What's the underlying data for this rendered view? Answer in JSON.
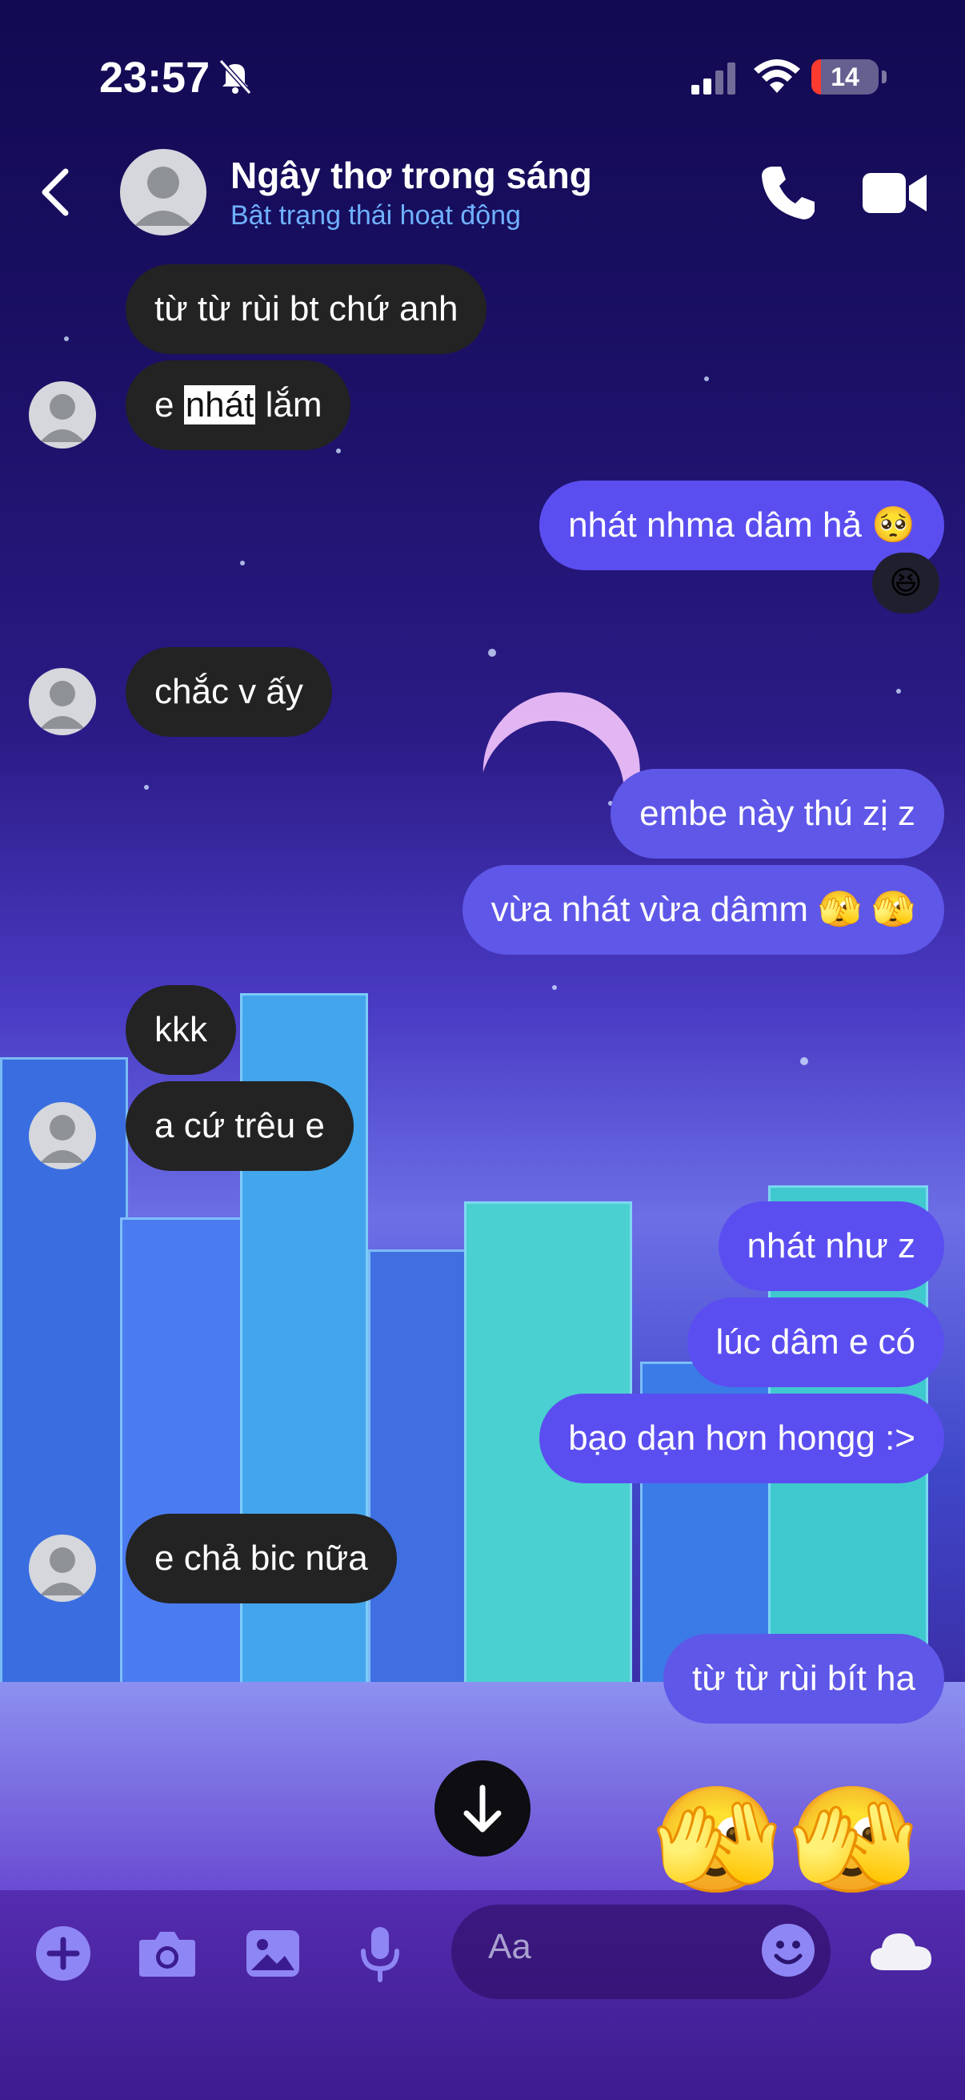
{
  "status_bar": {
    "time": "23:57",
    "battery": "14",
    "battery_level": 0.14
  },
  "header": {
    "name": "Ngây thơ trong sáng",
    "status": "Bật trạng thái hoạt động"
  },
  "messages": [
    {
      "dir": "in",
      "text": "từ từ rùi bt chứ anh"
    },
    {
      "dir": "in",
      "pre": "e ",
      "highlight": "nhát",
      "post": " lắm"
    },
    {
      "dir": "out",
      "text": "nhát nhma dâm hả 🥺",
      "reaction": "😆"
    },
    {
      "dir": "in",
      "text": "chắc v ấy"
    },
    {
      "dir": "out",
      "text": "embe này thú zị z"
    },
    {
      "dir": "out",
      "text": "vừa nhát vừa dâmm 🫣 🫣"
    },
    {
      "dir": "in",
      "text": "kkk"
    },
    {
      "dir": "in",
      "text": "a cứ trêu e"
    },
    {
      "dir": "out",
      "text": "nhát như z"
    },
    {
      "dir": "out",
      "text": "lúc dâm e có"
    },
    {
      "dir": "out",
      "text": "bạo dạn hơn hongg :>"
    },
    {
      "dir": "in",
      "text": "e chả bic nữa"
    },
    {
      "dir": "out",
      "text": "từ từ rùi bít ha"
    },
    {
      "dir": "out",
      "emojis": [
        "🫣",
        "🫣"
      ]
    }
  ],
  "composer": {
    "placeholder": "Aa"
  },
  "icons": [
    "back-icon",
    "call-icon",
    "video-icon",
    "plus-icon",
    "camera-icon",
    "image-icon",
    "mic-icon",
    "emoji-icon",
    "cloud-icon",
    "arrow-down-icon"
  ],
  "colors": {
    "incoming_bubble": "#232323",
    "outgoing_bubble": "#5b4ef0",
    "status_link": "#6fb1ff"
  }
}
